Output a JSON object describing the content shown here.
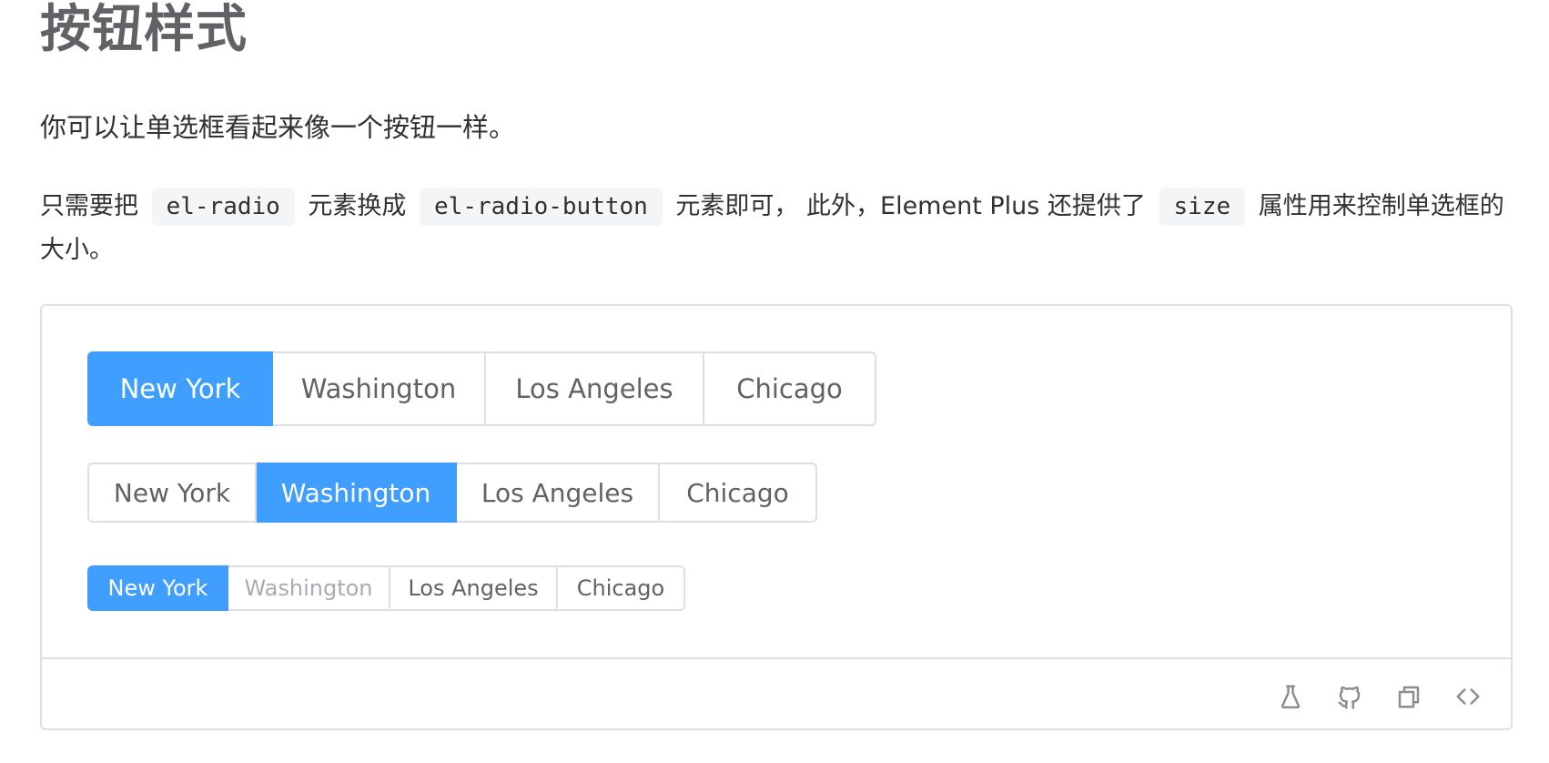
{
  "section": {
    "title": "按钮样式",
    "intro": "你可以让单选框看起来像一个按钮一样。",
    "desc": {
      "part1": "只需要把",
      "code1": "el-radio",
      "part2": "元素换成",
      "code2": "el-radio-button",
      "part3": "元素即可， 此外，Element Plus 还提供了",
      "code3": "size",
      "part4": "属性用来控制单选框的大小。"
    }
  },
  "demo": {
    "groups": [
      {
        "size": "large",
        "selected": "New York",
        "options": [
          "New York",
          "Washington",
          "Los Angeles",
          "Chicago"
        ]
      },
      {
        "size": "default",
        "selected": "Washington",
        "options": [
          "New York",
          "Washington",
          "Los Angeles",
          "Chicago"
        ]
      },
      {
        "size": "small",
        "selected": "New York",
        "disabled": [
          "Washington"
        ],
        "options": [
          "New York",
          "Washington",
          "Los Angeles",
          "Chicago"
        ]
      }
    ],
    "colors": {
      "accent": "#409eff",
      "border": "#dcdfe6",
      "text": "#606266",
      "disabled_text": "#a8abb2",
      "icon": "#8b8e94"
    },
    "toolbar_icons": [
      "flask-icon",
      "github-icon",
      "copy-icon",
      "code-icon"
    ]
  }
}
